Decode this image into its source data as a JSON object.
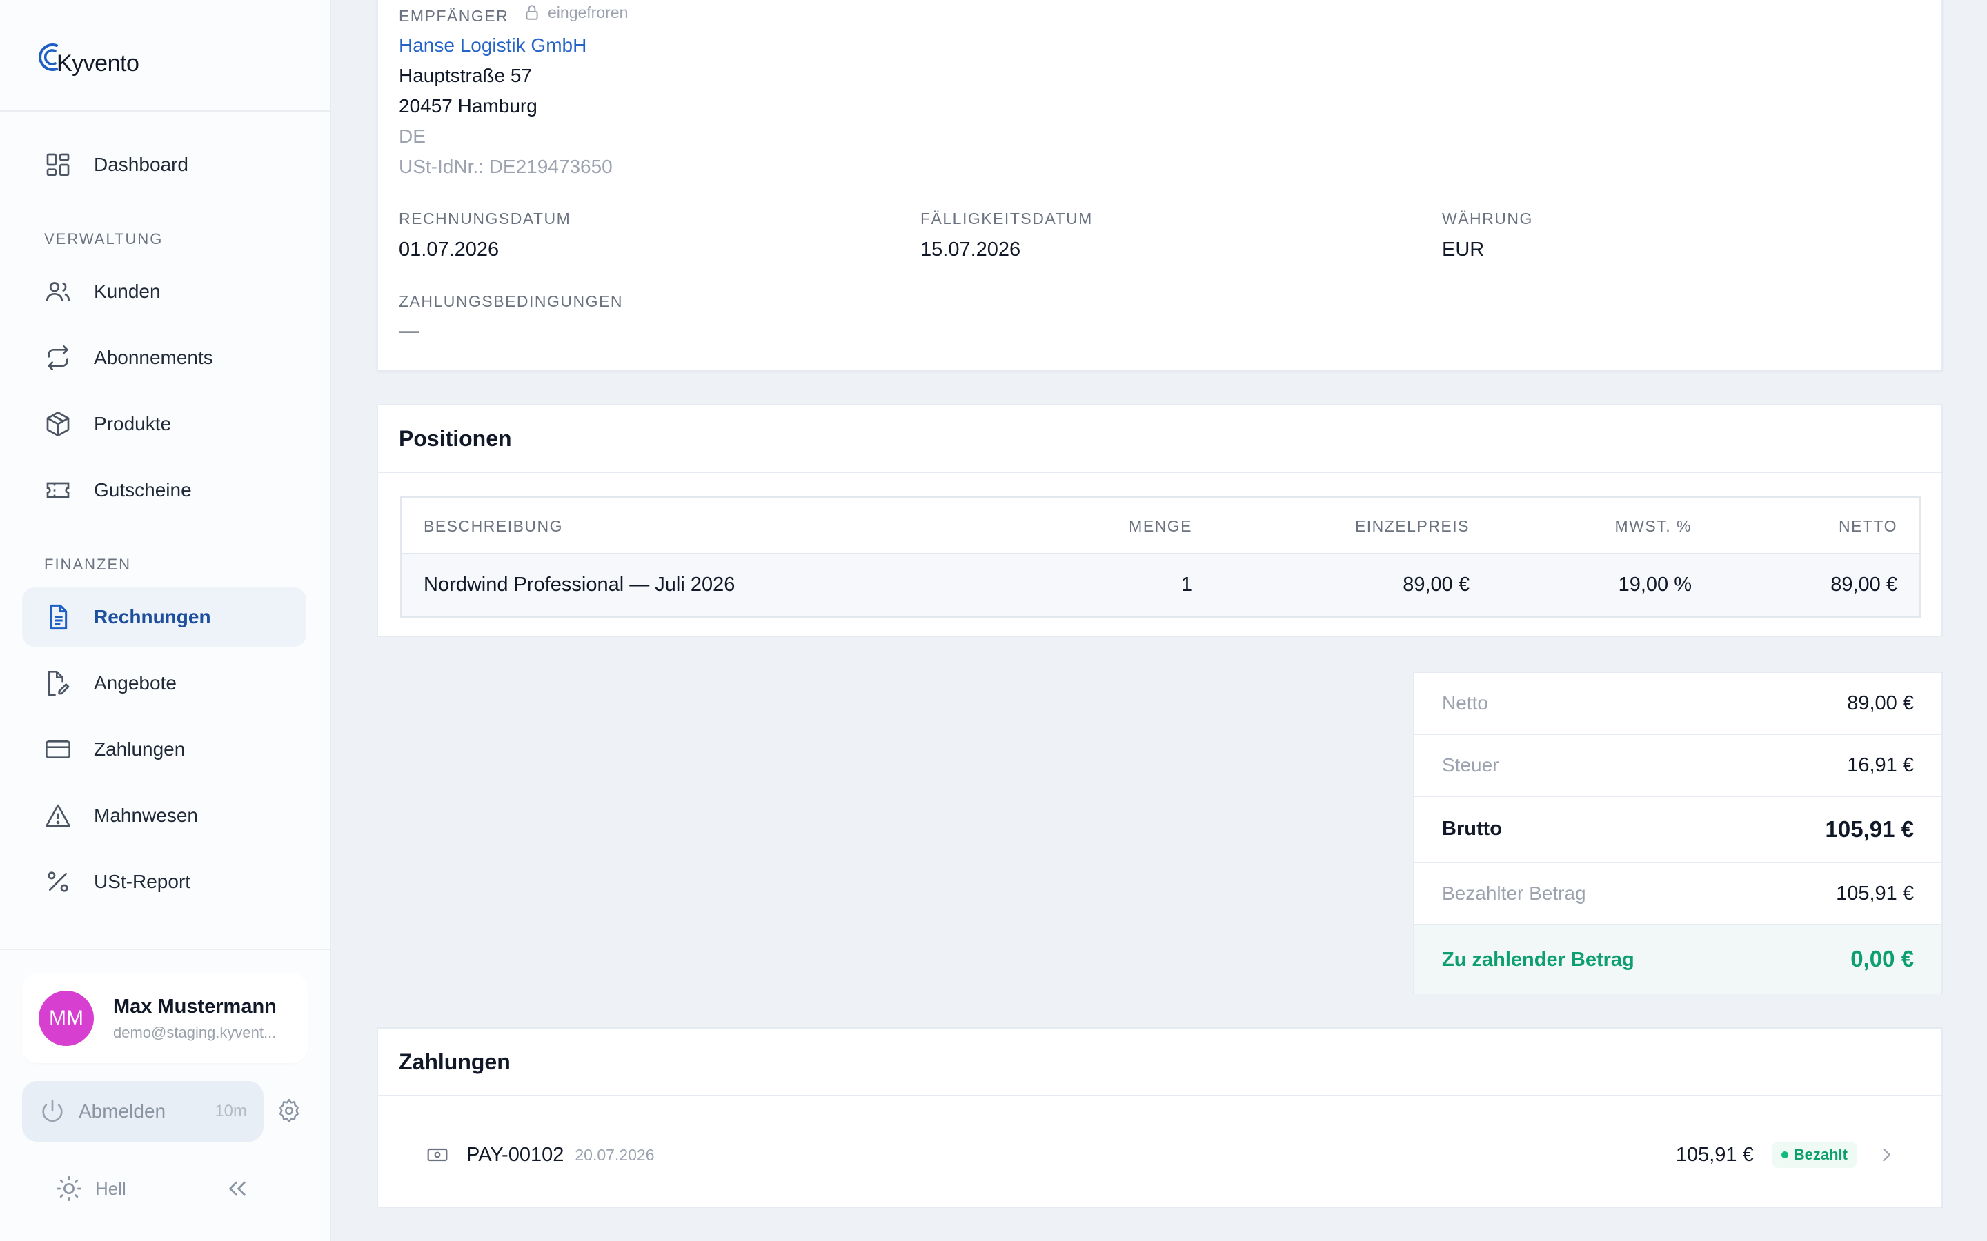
{
  "app": {
    "name": "Kyvento"
  },
  "sidebar": {
    "dashboard": "Dashboard",
    "section_verwaltung": "VERWALTUNG",
    "verwaltung": [
      {
        "label": "Kunden",
        "icon": "users-icon"
      },
      {
        "label": "Abonnements",
        "icon": "repeat-icon"
      },
      {
        "label": "Produkte",
        "icon": "box-icon"
      },
      {
        "label": "Gutscheine",
        "icon": "ticket-icon"
      }
    ],
    "section_finanzen": "FINANZEN",
    "finanzen": [
      {
        "label": "Rechnungen",
        "icon": "document-icon",
        "active": true
      },
      {
        "label": "Angebote",
        "icon": "document-edit-icon"
      },
      {
        "label": "Zahlungen",
        "icon": "credit-card-icon"
      },
      {
        "label": "Mahnwesen",
        "icon": "warning-icon"
      },
      {
        "label": "USt-Report",
        "icon": "percent-icon"
      }
    ],
    "user": {
      "initials": "MM",
      "name": "Max Mustermann",
      "email": "demo@staging.kyvent..."
    },
    "logout": {
      "label": "Abmelden",
      "timer": "10m"
    },
    "theme": "Hell"
  },
  "invoice": {
    "recipient_label": "EMPFÄNGER",
    "frozen_label": "eingefroren",
    "recipient": {
      "company": "Hanse Logistik GmbH",
      "street": "Hauptstraße 57",
      "city": "20457 Hamburg",
      "country": "DE",
      "vat_id": "USt-IdNr.: DE219473650"
    },
    "fields": {
      "invoice_date_label": "RECHNUNGSDATUM",
      "invoice_date": "01.07.2026",
      "due_date_label": "FÄLLIGKEITSDATUM",
      "due_date": "15.07.2026",
      "currency_label": "WÄHRUNG",
      "currency": "EUR",
      "payment_terms_label": "ZAHLUNGSBEDINGUNGEN",
      "payment_terms": "—"
    }
  },
  "positions": {
    "title": "Positionen",
    "columns": [
      "BESCHREIBUNG",
      "MENGE",
      "EINZELPREIS",
      "MWST. %",
      "NETTO"
    ],
    "rows": [
      [
        "Nordwind Professional — Juli 2026",
        "1",
        "89,00 €",
        "19,00 %",
        "89,00 €"
      ]
    ]
  },
  "totals": {
    "netto_label": "Netto",
    "netto": "89,00 €",
    "steuer_label": "Steuer",
    "steuer": "16,91 €",
    "brutto_label": "Brutto",
    "brutto": "105,91 €",
    "paid_label": "Bezahlter Betrag",
    "paid": "105,91 €",
    "due_label": "Zu zahlender Betrag",
    "due": "0,00 €"
  },
  "payments": {
    "title": "Zahlungen",
    "items": [
      {
        "id": "PAY-00102",
        "date": "20.07.2026",
        "amount": "105,91 €",
        "status": "Bezahlt"
      }
    ]
  },
  "colors": {
    "accent": "#1d5fc4",
    "success": "#0e9f6e",
    "avatar": "#d63fd0"
  }
}
